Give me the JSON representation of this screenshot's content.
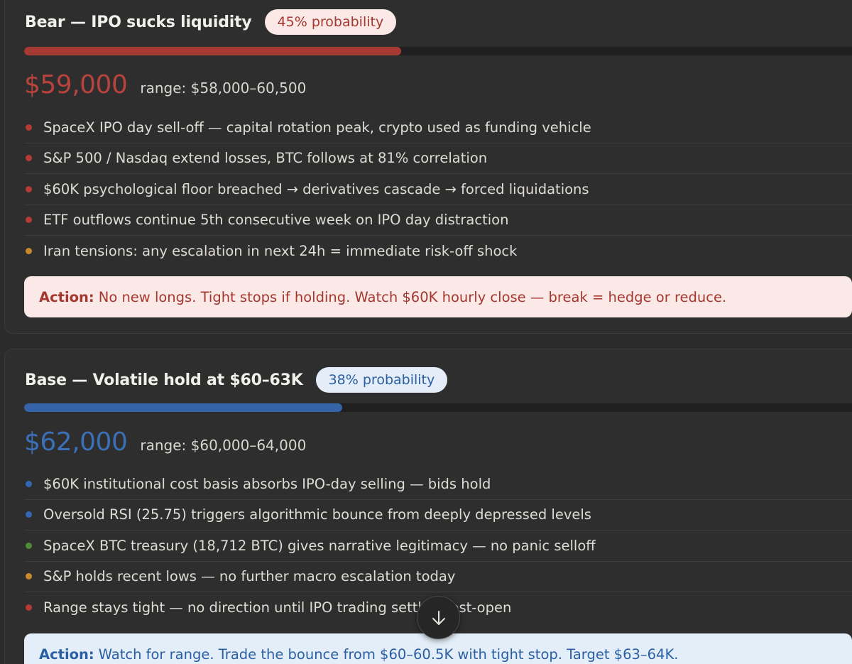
{
  "scenarios": [
    {
      "key": "bear",
      "title": "Bear — IPO sucks liquidity",
      "probability_label": "45% probability",
      "probability": 0.45,
      "price": "$59,000",
      "range": "range: $58,000–60,500",
      "bullets": [
        {
          "text": "SpaceX IPO day sell-off — capital rotation peak, crypto used as funding vehicle",
          "color": "#b63a35"
        },
        {
          "text": "S&P 500 / Nasdaq extend losses, BTC follows at 81% correlation",
          "color": "#b63a35"
        },
        {
          "text": "$60K psychological floor breached → derivatives cascade → forced liquidations",
          "color": "#b63a35"
        },
        {
          "text": "ETF outflows continue 5th consecutive week on IPO day distraction",
          "color": "#b63a35"
        },
        {
          "text": "Iran tensions: any escalation in next 24h = immediate risk-off shock",
          "color": "#c98a2e"
        }
      ],
      "action_label": "Action:",
      "action_text": "No new longs. Tight stops if holding. Watch $60K hourly close — break = hedge or reduce."
    },
    {
      "key": "base",
      "title": "Base — Volatile hold at $60–63K",
      "probability_label": "38% probability",
      "probability": 0.38,
      "price": "$62,000",
      "range": "range: $60,000–64,000",
      "bullets": [
        {
          "text": "$60K institutional cost basis absorbs IPO-day selling — bids hold",
          "color": "#3566b0"
        },
        {
          "text": "Oversold RSI (25.75) triggers algorithmic bounce from deeply depressed levels",
          "color": "#3566b0"
        },
        {
          "text": "SpaceX BTC treasury (18,712 BTC) gives narrative legitimacy — no panic selloff",
          "color": "#4f8a35"
        },
        {
          "text": "S&P holds recent lows — no further macro escalation today",
          "color": "#c98a2e"
        },
        {
          "text": "Range stays tight — no direction until IPO trading settles post-open",
          "color": "#b63a35"
        }
      ],
      "action_label": "Action:",
      "action_text": "Watch for range. Trade the bounce from $60–60.5K with tight stop. Target $63–64K."
    }
  ],
  "scroll_button": {
    "icon": "arrow-down-icon"
  }
}
